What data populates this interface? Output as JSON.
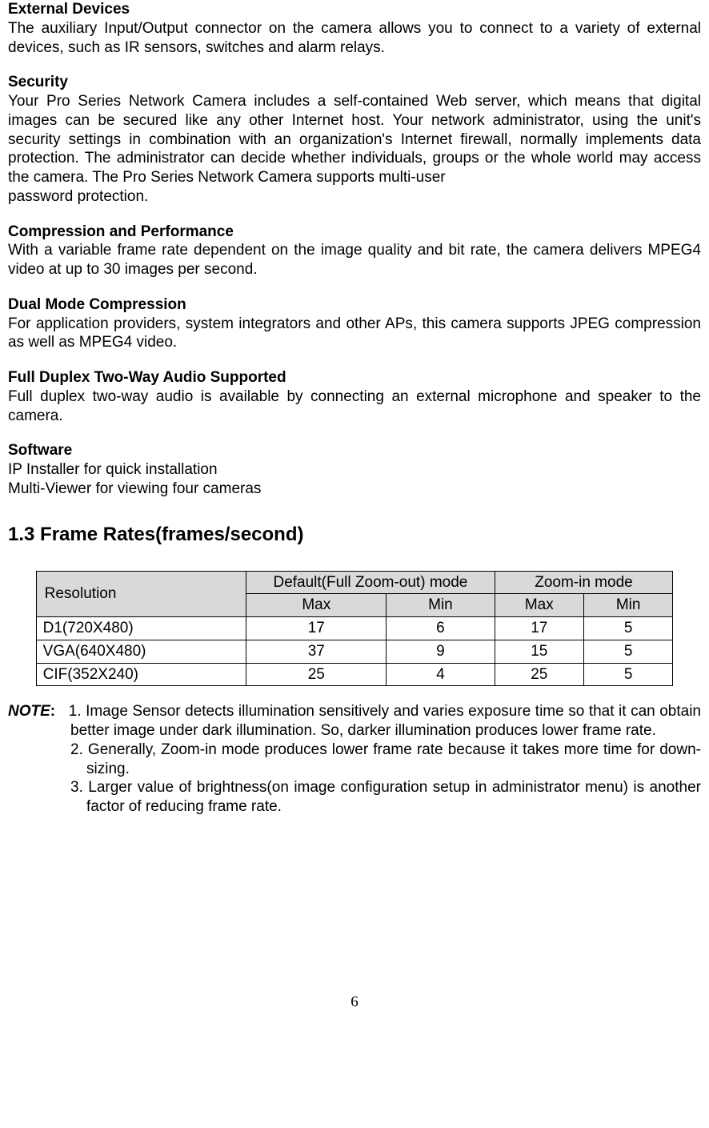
{
  "sections": {
    "external_devices": {
      "title": "External Devices",
      "body": "The auxiliary Input/Output connector on the camera allows you to connect to a variety of external devices, such as IR sensors, switches and alarm relays."
    },
    "security": {
      "title": "Security",
      "body": "Your Pro Series Network Camera includes a self-contained Web server, which means that digital images can be secured like any other Internet host. Your network administrator, using the unit's security settings in combination with an organization's Internet firewall, normally implements data protection. The administrator can decide whether individuals, groups or the whole world may access the camera. The Pro Series Network Camera supports multi-user",
      "body_last": "password protection."
    },
    "compression": {
      "title": "Compression and Performance",
      "body": "With a variable frame rate dependent on the image quality and bit rate, the camera delivers MPEG4 video at up to 30 images per second."
    },
    "dual_mode": {
      "title": "Dual Mode Compression",
      "body": "For application providers, system integrators and other APs, this camera supports JPEG compression as well as MPEG4 video."
    },
    "duplex": {
      "title": "Full Duplex Two-Way Audio Supported",
      "body": "Full duplex two-way audio is available by connecting an external microphone and speaker to the camera."
    },
    "software": {
      "title": "Software",
      "line1": "IP Installer for quick installation",
      "line2": "Multi-Viewer for viewing four cameras"
    }
  },
  "frame_rates_title": "1.3 Frame Rates(frames/second)",
  "table": {
    "headers": {
      "resolution": "Resolution",
      "default_mode": "Default(Full Zoom-out) mode",
      "zoom_in_mode": "Zoom-in mode",
      "max": "Max",
      "min": "Min"
    },
    "rows": [
      {
        "resolution": "D1(720X480)",
        "def_max": "17",
        "def_min": "6",
        "zoom_max": "17",
        "zoom_min": "5"
      },
      {
        "resolution": "VGA(640X480)",
        "def_max": "37",
        "def_min": "9",
        "zoom_max": "15",
        "zoom_min": "5"
      },
      {
        "resolution": "CIF(352X240)",
        "def_max": "25",
        "def_min": "4",
        "zoom_max": "25",
        "zoom_min": "5"
      }
    ]
  },
  "note": {
    "label": "NOTE",
    "colon": ":",
    "item1": "1. Image Sensor detects illumination sensitively and varies exposure time so that it can obtain better image under dark illumination. So, darker illumination produces lower frame rate.",
    "item2": "2. Generally, Zoom-in mode produces lower frame rate because it takes more time for down-sizing.",
    "item3": "3. Larger value of brightness(on image configuration setup in administrator menu) is another factor of reducing frame rate."
  },
  "page_number": "6"
}
